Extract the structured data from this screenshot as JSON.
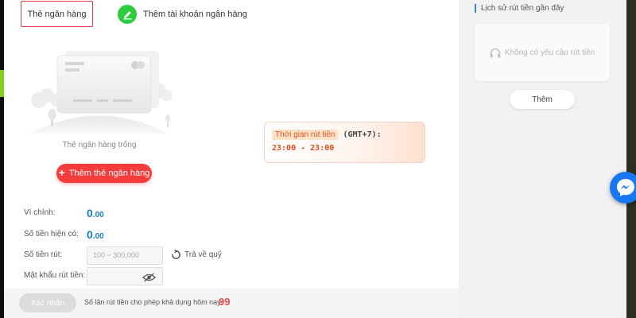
{
  "tabs": {
    "bank_card": "Thẻ ngân hàng"
  },
  "header": {
    "add_account_label": "Thêm tài khoản ngân hàng"
  },
  "empty_state": {
    "text": "Thẻ ngân hàng trống",
    "add_card_button": "Thêm thẻ ngân hàng"
  },
  "withdraw_time": {
    "tag": "Thời gian rút tiền",
    "timezone": "(GMT+7):",
    "range": "23:00 - 23:00"
  },
  "form": {
    "main_wallet_label": "Ví chính:",
    "main_wallet_value_int": "0",
    "main_wallet_value_dec": ".00",
    "available_label": "Số tiền hiện có:",
    "available_value_int": "0",
    "available_value_dec": ".00",
    "amount_label": "Số tiền rút:",
    "amount_placeholder": "100 ~ 300,000",
    "refund_label": "Trả về quỹ",
    "password_label": "Mật khẩu rút tiền:"
  },
  "footer": {
    "confirm_button": "Xác nhận",
    "limit_text": "Số lần rút tiền cho phép khả dụng hôm nay:",
    "limit_value": "99"
  },
  "sidebar": {
    "title": "Lịch sử rút tiền gần đây",
    "empty_text": "Không có yêu cầu rút tiền",
    "more_button": "Thêm"
  },
  "colors": {
    "accent_red": "#f53b3b",
    "accent_green": "#2ecc40",
    "amount_blue": "#1a7fb8",
    "messenger_blue": "#1778f2"
  },
  "icons": [
    "pen-icon",
    "card-illustration",
    "plus-icon",
    "refresh-icon",
    "eye-off-icon",
    "headset-icon",
    "messenger-icon"
  ]
}
